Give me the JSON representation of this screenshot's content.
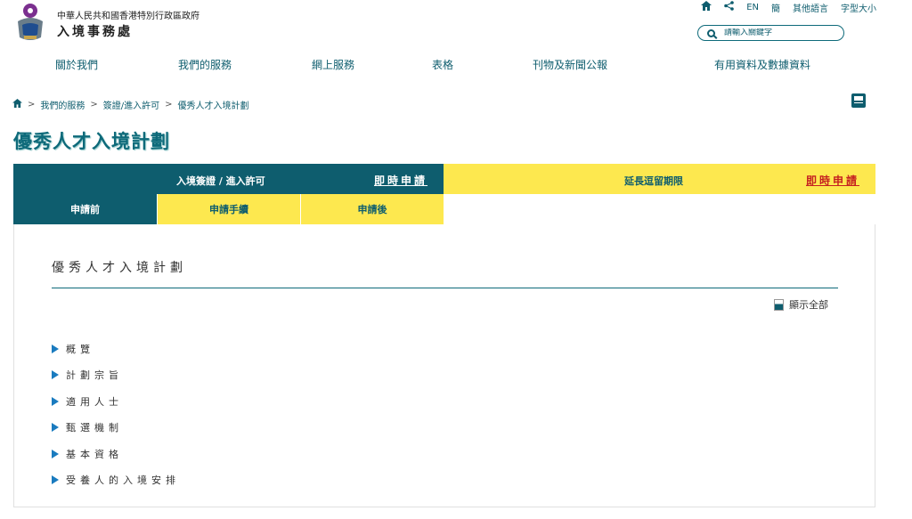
{
  "header": {
    "gov_name": "中華人民共和國香港特別行政區政府",
    "dept_name": "入境事務處"
  },
  "utility": {
    "lang_en": "EN",
    "lang_sc": "簡",
    "other_lang": "其他語言",
    "font_size": "字型大小"
  },
  "search": {
    "placeholder": "請輸入關鍵字"
  },
  "nav": {
    "about": "關於我們",
    "services": "我們的服務",
    "online": "網上服務",
    "forms": "表格",
    "publications": "刊物及新聞公報",
    "info": "有用資料及數據資料"
  },
  "breadcrumb": {
    "l1": "我們的服務",
    "l2": "簽證/進入許可",
    "l3": "優秀人才入境計劃"
  },
  "page": {
    "title": "優秀人才入境計劃"
  },
  "tabs": {
    "entry_label": "入境簽證 / 進入許可",
    "entry_apply": "即時申請",
    "extend_label": "延長逗留期限",
    "extend_apply": "即時申請"
  },
  "subtabs": {
    "before": "申請前",
    "procedure": "申請手續",
    "after": "申請後"
  },
  "content": {
    "title": "優秀人才入境計劃",
    "show_all": "顯示全部",
    "items": [
      "概覽",
      "計劃宗旨",
      "適用人士",
      "甄選機制",
      "基本資格",
      "受養人的入境安排"
    ]
  },
  "colors": {
    "teal": "#0e5d6e",
    "yellow": "#fde84f",
    "red_link": "#c52020",
    "arrow_blue": "#1a7bbf"
  }
}
